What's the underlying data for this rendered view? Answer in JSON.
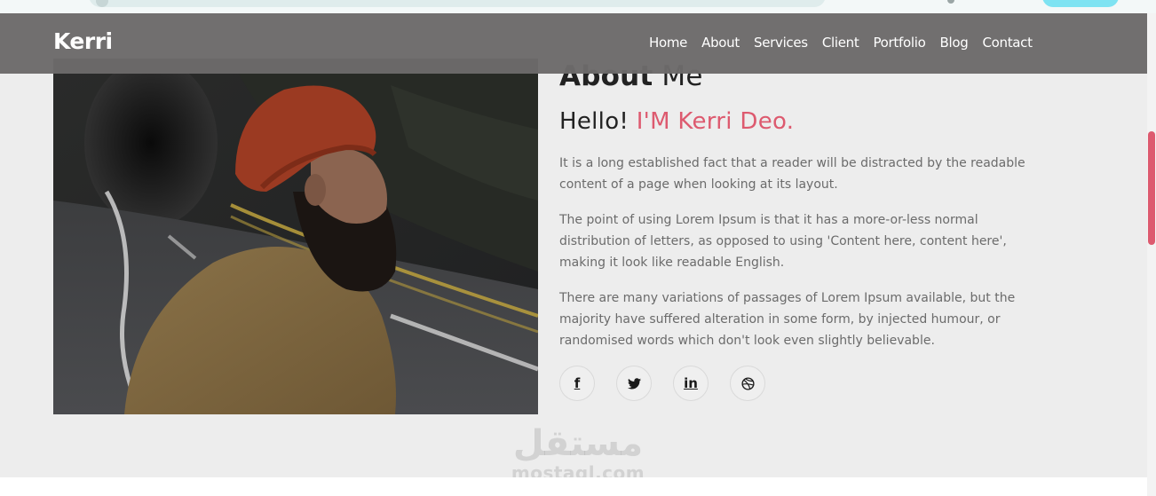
{
  "brand": "Kerri",
  "nav": [
    "Home",
    "About",
    "Services",
    "Client",
    "Portfolio",
    "Blog",
    "Contact"
  ],
  "about": {
    "title_bold": "About",
    "title_rest": " Me",
    "hello": "Hello!",
    "name": "I'M Kerri Deo.",
    "paragraphs": [
      "It is a long established fact that a reader will be distracted by the readable content of a page when looking at its layout.",
      "The point of using Lorem Ipsum is that it has a more-or-less normal distribution of letters, as opposed to using 'Content here, content here', making it look like readable English.",
      "There are many variations of passages of Lorem Ipsum available, but the majority have suffered alteration in some form, by injected humour, or randomised words which don't look even slightly believable."
    ]
  },
  "socials": [
    {
      "icon": "facebook-icon",
      "glyph": "f"
    },
    {
      "icon": "twitter-icon",
      "glyph": ""
    },
    {
      "icon": "linkedin-icon",
      "glyph": "in"
    },
    {
      "icon": "dribbble-icon",
      "glyph": ""
    }
  ],
  "watermark": {
    "arabic": "مستقل",
    "latin": "mostaql.com"
  },
  "colors": {
    "accent": "#dd5a6f",
    "navbar": "#6c6a6a",
    "background": "#ededed"
  }
}
